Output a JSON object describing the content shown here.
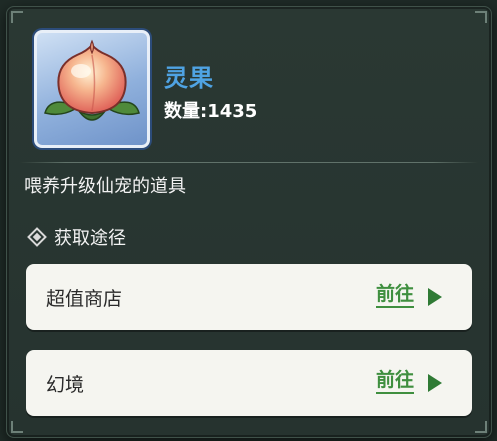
{
  "item": {
    "name": "灵果",
    "count_text": "数量:1435",
    "description": "喂养升级仙宠的道具"
  },
  "source": {
    "title": "获取途径",
    "rows": [
      {
        "label": "超值商店",
        "action": "前往"
      },
      {
        "label": "幻境",
        "action": "前往"
      }
    ]
  },
  "colors": {
    "name": "#4fa3e3",
    "action": "#3f8f3f",
    "panel": "#26332f",
    "row_bg": "#f5f5f0"
  },
  "icons": {
    "item": "spirit-fruit-peach-icon",
    "source_marker": "diamond-icon",
    "go": "arrow-right-icon"
  }
}
